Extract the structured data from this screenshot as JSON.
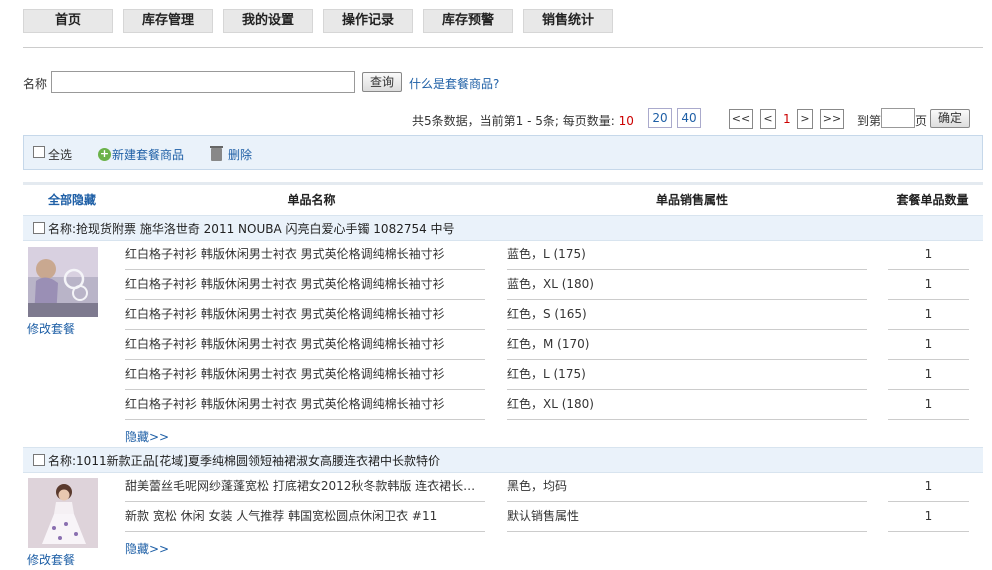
{
  "nav": [
    "首页",
    "库存管理",
    "我的设置",
    "操作记录",
    "库存预警",
    "销售统计"
  ],
  "search": {
    "label": "名称",
    "value": "",
    "button": "查询",
    "help": "什么是套餐商品?"
  },
  "pager": {
    "summary": "共5条数据，当前第1 - 5条; 每页数量: ",
    "size_current": "10",
    "sizes": [
      "20",
      "40"
    ],
    "first": "<<",
    "prev": "<",
    "page": "1",
    "next": ">",
    "last": ">>",
    "goto_label": "到第",
    "goto_suffix": "页",
    "confirm": "确定"
  },
  "toolbar": {
    "select_all": "全选",
    "new": "新建套餐商品",
    "delete": "删除"
  },
  "columns": [
    "全部隐藏",
    "单品名称",
    "单品销售属性",
    "套餐单品数量"
  ],
  "groups": [
    {
      "title": "名称:抢现货附票 施华洛世奇 2011 NOUBA 闪亮白爱心手镯 1082754 中号",
      "edit": "修改套餐",
      "hide": "隐藏>>",
      "items": [
        {
          "name": "红白格子衬衫 韩版休闲男士衬衣 男式英伦格调纯棉长袖寸衫",
          "attr": "蓝色，L (175)",
          "qty": "1"
        },
        {
          "name": "红白格子衬衫 韩版休闲男士衬衣 男式英伦格调纯棉长袖寸衫",
          "attr": "蓝色，XL (180)",
          "qty": "1"
        },
        {
          "name": "红白格子衬衫 韩版休闲男士衬衣 男式英伦格调纯棉长袖寸衫",
          "attr": "红色，S (165)",
          "qty": "1"
        },
        {
          "name": "红白格子衬衫 韩版休闲男士衬衣 男式英伦格调纯棉长袖寸衫",
          "attr": "红色，M (170)",
          "qty": "1"
        },
        {
          "name": "红白格子衬衫 韩版休闲男士衬衣 男式英伦格调纯棉长袖寸衫",
          "attr": "红色，L (175)",
          "qty": "1"
        },
        {
          "name": "红白格子衬衫 韩版休闲男士衬衣 男式英伦格调纯棉长袖寸衫",
          "attr": "红色，XL (180)",
          "qty": "1"
        }
      ]
    },
    {
      "title": "名称:1011新款正品[花域]夏季纯棉圆领短袖裙淑女高腰连衣裙中长款特价",
      "edit": "修改套餐",
      "hide": "隐藏>>",
      "items": [
        {
          "name": "甜美蕾丝毛呢网纱蓬蓬宽松 打底裙女2012秋冬款韩版 连衣裙长…",
          "attr": "黑色，均码",
          "qty": "1"
        },
        {
          "name": "新款 宽松 休闲 女装 人气推荐 韩国宽松圆点休闲卫衣 #11",
          "attr": "默认销售属性",
          "qty": "1"
        }
      ]
    }
  ]
}
